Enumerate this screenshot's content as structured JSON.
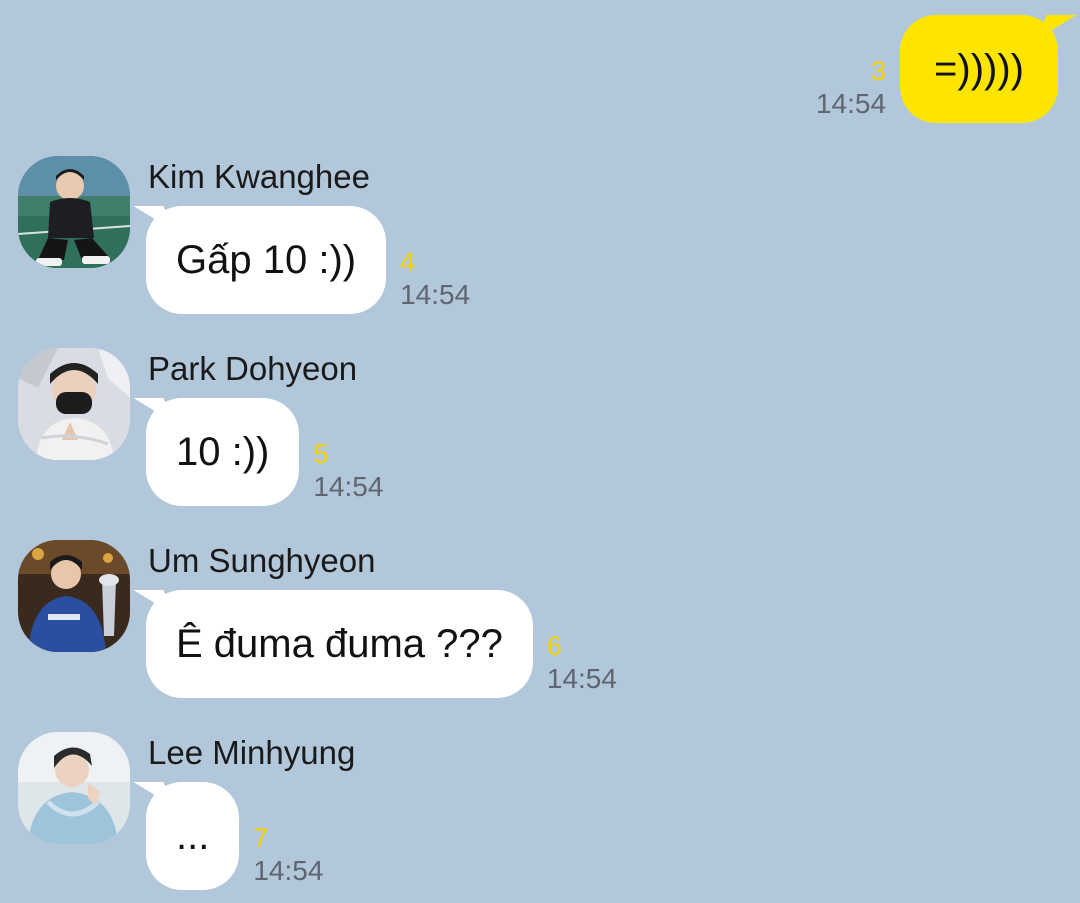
{
  "outgoing": {
    "text": "=)))))",
    "unread": "3",
    "time": "14:54"
  },
  "messages": [
    {
      "sender": "Kim Kwanghee",
      "text": "Gấp 10 :))",
      "unread": "4",
      "time": "14:54"
    },
    {
      "sender": "Park Dohyeon",
      "text": "10 :))",
      "unread": "5",
      "time": "14:54"
    },
    {
      "sender": "Um Sunghyeon",
      "text": "Ê đuma đuma ???",
      "unread": "6",
      "time": "14:54"
    },
    {
      "sender": "Lee Minhyung",
      "text": "...",
      "unread": "7",
      "time": "14:54"
    }
  ],
  "colors": {
    "background": "#b2c7da",
    "outgoing_bubble": "#fee500",
    "incoming_bubble": "#ffffff",
    "unread_count": "#f5d300",
    "timestamp": "#5e6670"
  },
  "icons": {
    "avatar_1": "profile-photo-icon",
    "avatar_2": "profile-photo-icon",
    "avatar_3": "profile-photo-icon",
    "avatar_4": "profile-photo-icon"
  }
}
